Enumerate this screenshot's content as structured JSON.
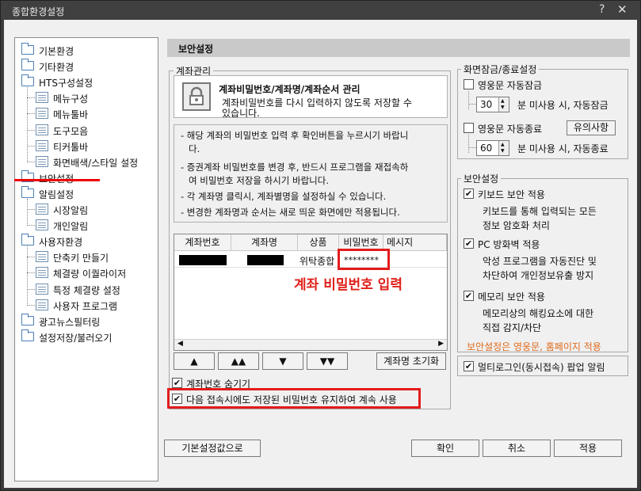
{
  "window": {
    "title": "종합환경설정",
    "help": "?",
    "close": "✕"
  },
  "tree": {
    "items": [
      {
        "label": "기본환경",
        "type": "folder",
        "level": 0
      },
      {
        "label": "기타환경",
        "type": "folder",
        "level": 0
      },
      {
        "label": "HTS구성설정",
        "type": "folder",
        "level": 0
      },
      {
        "label": "메뉴구성",
        "type": "doc",
        "level": 1
      },
      {
        "label": "메뉴툴바",
        "type": "doc",
        "level": 1
      },
      {
        "label": "도구모음",
        "type": "doc",
        "level": 1
      },
      {
        "label": "티커툴바",
        "type": "doc",
        "level": 1
      },
      {
        "label": "화면배색/스타일 설정",
        "type": "doc",
        "level": 1
      },
      {
        "label": "보안설정",
        "type": "folder",
        "level": 0,
        "selected": true
      },
      {
        "label": "알림설정",
        "type": "folder",
        "level": 0
      },
      {
        "label": "시장알림",
        "type": "doc",
        "level": 1
      },
      {
        "label": "개인알림",
        "type": "doc",
        "level": 1
      },
      {
        "label": "사용자환경",
        "type": "folder",
        "level": 0
      },
      {
        "label": "단축키 만들기",
        "type": "doc",
        "level": 1
      },
      {
        "label": "체결량 이퀄라이저",
        "type": "doc",
        "level": 1
      },
      {
        "label": "특정 체결량 설정",
        "type": "doc",
        "level": 1
      },
      {
        "label": "사용자 프로그램",
        "type": "doc",
        "level": 1
      },
      {
        "label": "광고뉴스필터링",
        "type": "folder",
        "level": 0
      },
      {
        "label": "설정저장/불러오기",
        "type": "folder",
        "level": 0
      }
    ]
  },
  "header": {
    "title": "보안설정"
  },
  "account": {
    "group_label": "계좌관리",
    "info_title": "계좌비밀번호/계좌명/계좌순서 관리",
    "info_desc_1": "계좌비밀번호를 다시 입력하지 않도록 저장할 수",
    "info_desc_2": "있습니다.",
    "notes": [
      "- 해당 계좌의 비밀번호 입력 후 확인버튼을 누르시기 바랍니",
      "다.",
      "- 증권계좌 비밀번호를 변경 후, 반드시 프로그램을 재접속하",
      "여 비밀번호 저장을 하시기 바랍니다.",
      "- 각 계좌명 클릭시, 계좌별명을 설정하실 수 있습니다.",
      "- 변경한 계좌명과 순서는 새로 띄운 화면에만 적용됩니다."
    ],
    "columns": [
      "계좌번호",
      "계좌명",
      "상품",
      "비밀번호",
      "메시지"
    ],
    "row": {
      "product": "위탁종합",
      "password": "********"
    },
    "annotation": "계좌 비밀번호 입력",
    "move_buttons": [
      "▲",
      "▲▲",
      "▼",
      "▼▼"
    ],
    "reset_name_button": "계좌명 초기화",
    "hide_account_label": "계좌번호 숨기기",
    "keep_password_label": "다음 접속시에도 저장된 비밀번호 유지하여 계속 사용"
  },
  "screenlock": {
    "group_label": "화면잠금/종료설정",
    "autolock_label": "영웅문 자동잠금",
    "autolock_minutes": "30",
    "autolock_suffix": "분 미사용 시, 자동잠금",
    "autoexit_label": "영웅문 자동종료",
    "notice_button": "유의사항",
    "autoexit_minutes": "60",
    "autoexit_suffix": "분 미사용 시, 자동종료"
  },
  "security": {
    "group_label": "보안설정",
    "keyboard_label": "키보드 보안 적용",
    "keyboard_desc_1": "키보드를 통해 입력되는 모든",
    "keyboard_desc_2": "정보 암호화 처리",
    "firewall_label": "PC 방화벽 적용",
    "firewall_desc_1": "악성 프로그램을 자동진단 및",
    "firewall_desc_2": "차단하여 개인정보유출 방지",
    "memory_label": "메모리 보안 적용",
    "memory_desc_1": "메모리상의 해킹요소에 대한",
    "memory_desc_2": "직접 감지/차단",
    "note": "보안설정은 영웅문, 홈페이지 적용"
  },
  "multilogin": {
    "label": "멀티로그인(동시접속) 팝업 알림"
  },
  "footer": {
    "defaults_button": "기본설정값으로",
    "ok_button": "확인",
    "cancel_button": "취소",
    "apply_button": "적용"
  },
  "colors": {
    "annotation_red": "#e31c1c",
    "note_orange": "#e06a1a",
    "header_gray": "#c9c9c9"
  }
}
